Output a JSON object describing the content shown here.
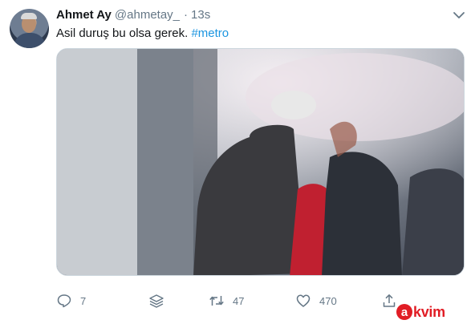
{
  "tweet": {
    "author_name": "Ahmet Ay",
    "author_handle": "@ahmetay_",
    "separator": "·",
    "timestamp": "13s",
    "text_plain": "Asil duruş bu olsa gerek.",
    "hashtag": "#metro"
  },
  "actions": {
    "reply_count": "7",
    "retweet_count": "47",
    "like_count": "470"
  },
  "icons": {
    "more": "chevron-down-icon",
    "reply": "reply-icon",
    "stack": "stack-icon",
    "retweet": "retweet-icon",
    "like": "heart-icon",
    "share": "share-icon"
  },
  "watermark": {
    "badge": "a",
    "text": "kvim"
  },
  "colors": {
    "accent": "#1b95e0",
    "muted": "#657786",
    "watermark": "#e11d25"
  }
}
